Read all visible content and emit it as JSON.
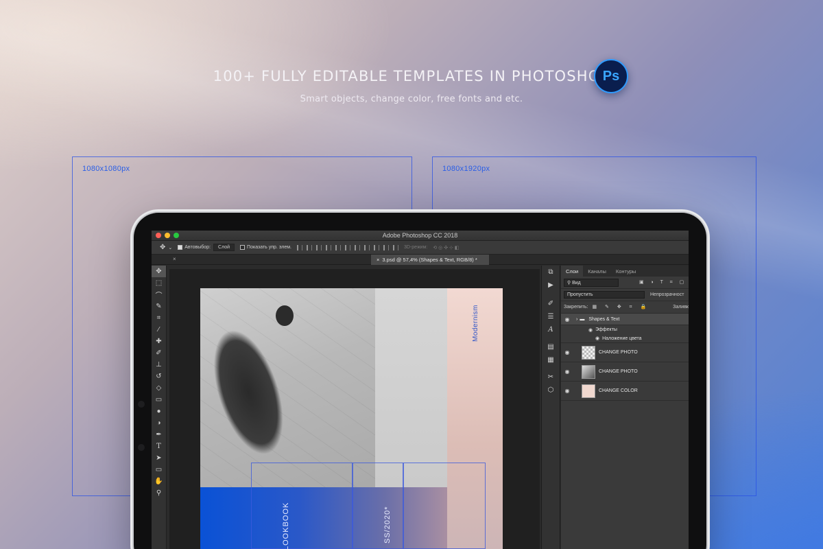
{
  "hero": {
    "headline": "100+ FULLY EDITABLE TEMPLATES IN PHOTOSHOP",
    "subhead": "Smart objects, change color, free fonts and etc.",
    "badge": "Ps"
  },
  "frames": [
    {
      "label": "1080x1080px"
    },
    {
      "label": "1080x1920px"
    }
  ],
  "app": {
    "window_title": "Adobe Photoshop CC 2018",
    "options": {
      "autoselect_label": "Автовыбор:",
      "autoselect_value": "Слой",
      "show_controls_label": "Показать упр. элем.",
      "mode_3d": "3D-режим:"
    },
    "doc_tab": "3.psd @ 57,4% (Shapes & Text, RGB/8) *",
    "panel_tabs": [
      "Слои",
      "Каналы",
      "Контуры"
    ],
    "filter_value": "Вид",
    "blend_value": "Пропустить",
    "opacity_label": "Непрозрачност",
    "lock_label": "Закрепить:",
    "fill_label": "Заливк",
    "layers": [
      {
        "name": "Shapes & Text",
        "type": "group"
      },
      {
        "name": "Эффекты",
        "type": "effects"
      },
      {
        "name": "Наложение цвета",
        "type": "effect"
      },
      {
        "name": "CHANGE PHOTO",
        "type": "smart"
      },
      {
        "name": "CHANGE PHOTO",
        "type": "smart"
      },
      {
        "name": "CHANGE COLOR",
        "type": "smart"
      }
    ]
  },
  "document": {
    "side_text": "Modernism",
    "lookbook": "LOOKBOOK",
    "season": "SS/2020*"
  },
  "colors": {
    "accent_blue": "#0a52d6",
    "ps_badge_bg": "#0a1e4e",
    "ps_badge_text": "#3aa6ff"
  }
}
